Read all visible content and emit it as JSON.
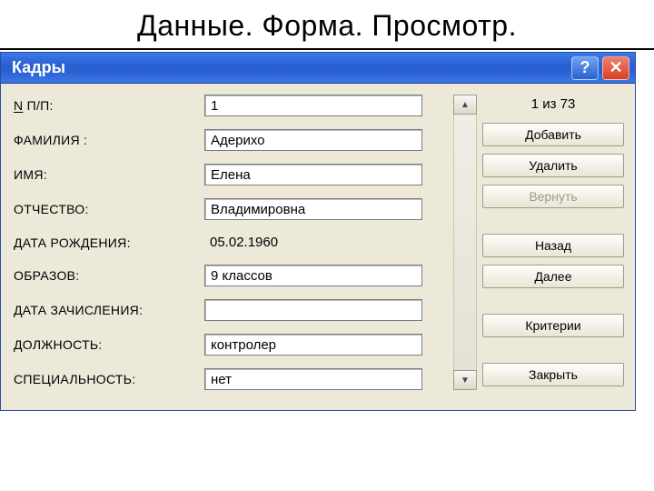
{
  "page_title": "Данные. Форма. Просмотр.",
  "window": {
    "title": "Кадры",
    "help_icon_text": "?",
    "close_icon_text": "✕"
  },
  "fields": {
    "npp": {
      "label": "N П/П:",
      "value": "1"
    },
    "surname": {
      "label": "ФАМИЛИЯ   :",
      "value": "Адерихо"
    },
    "name": {
      "label": "ИМЯ:",
      "value": "Елена"
    },
    "patronymic": {
      "label": "ОТЧЕСТВО:",
      "value": "Владимировна"
    },
    "dob": {
      "label": "ДАТА РОЖДЕНИЯ:",
      "value": "05.02.1960"
    },
    "education": {
      "label": "ОБРАЗОВ:",
      "value": "9 классов"
    },
    "enroll": {
      "label": "ДАТА ЗАЧИСЛЕНИЯ:",
      "value": ""
    },
    "position": {
      "label": "ДОЛЖНОСТЬ:",
      "value": "контролер"
    },
    "specialty": {
      "label": "СПЕЦИАЛЬНОСТЬ:",
      "value": "нет"
    }
  },
  "counter": "1 из 73",
  "buttons": {
    "add": "Добавить",
    "delete": "Удалить",
    "restore": "Вернуть",
    "back": "Назад",
    "next": "Далее",
    "criteria": "Критерии",
    "close": "Закрыть"
  },
  "scroll": {
    "up": "▲",
    "down": "▼"
  }
}
